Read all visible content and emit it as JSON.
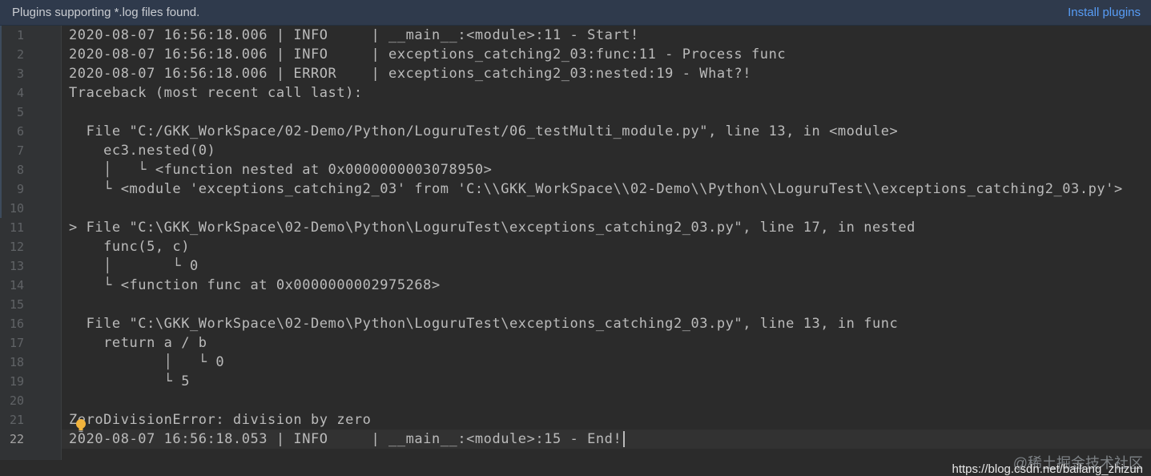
{
  "notification": {
    "message": "Plugins supporting *.log files found.",
    "action_label": "Install plugins"
  },
  "editor": {
    "current_line": 22,
    "lines": [
      {
        "number": "1",
        "text": "2020-08-07 16:56:18.006 | INFO     | __main__:<module>:11 - Start!"
      },
      {
        "number": "2",
        "text": "2020-08-07 16:56:18.006 | INFO     | exceptions_catching2_03:func:11 - Process func"
      },
      {
        "number": "3",
        "text": "2020-08-07 16:56:18.006 | ERROR    | exceptions_catching2_03:nested:19 - What?!"
      },
      {
        "number": "4",
        "text": "Traceback (most recent call last):"
      },
      {
        "number": "5",
        "text": ""
      },
      {
        "number": "6",
        "text": "  File \"C:/GKK_WorkSpace/02-Demo/Python/LoguruTest/06_testMulti_module.py\", line 13, in <module>"
      },
      {
        "number": "7",
        "text": "    ec3.nested(0)"
      },
      {
        "number": "8",
        "text": "    │   └ <function nested at 0x0000000003078950>"
      },
      {
        "number": "9",
        "text": "    └ <module 'exceptions_catching2_03' from 'C:\\\\GKK_WorkSpace\\\\02-Demo\\\\Python\\\\LoguruTest\\\\exceptions_catching2_03.py'>"
      },
      {
        "number": "10",
        "text": ""
      },
      {
        "number": "11",
        "text": "> File \"C:\\GKK_WorkSpace\\02-Demo\\Python\\LoguruTest\\exceptions_catching2_03.py\", line 17, in nested"
      },
      {
        "number": "12",
        "text": "    func(5, c)"
      },
      {
        "number": "13",
        "text": "    │       └ 0"
      },
      {
        "number": "14",
        "text": "    └ <function func at 0x0000000002975268>"
      },
      {
        "number": "15",
        "text": ""
      },
      {
        "number": "16",
        "text": "  File \"C:\\GKK_WorkSpace\\02-Demo\\Python\\LoguruTest\\exceptions_catching2_03.py\", line 13, in func"
      },
      {
        "number": "17",
        "text": "    return a / b"
      },
      {
        "number": "18",
        "text": "           │   └ 0"
      },
      {
        "number": "19",
        "text": "           └ 5"
      },
      {
        "number": "20",
        "text": ""
      },
      {
        "number": "21",
        "text": "ZeroDivisionError: division by zero"
      },
      {
        "number": "22",
        "text": "2020-08-07 16:56:18.053 | INFO     | __main__:<module>:15 - End!"
      }
    ]
  },
  "icons": {
    "intention": "lightbulb-icon"
  },
  "watermark": {
    "site": "@稀土掘金技术社区",
    "url": "https://blog.csdn.net/bailang_zhizun"
  }
}
